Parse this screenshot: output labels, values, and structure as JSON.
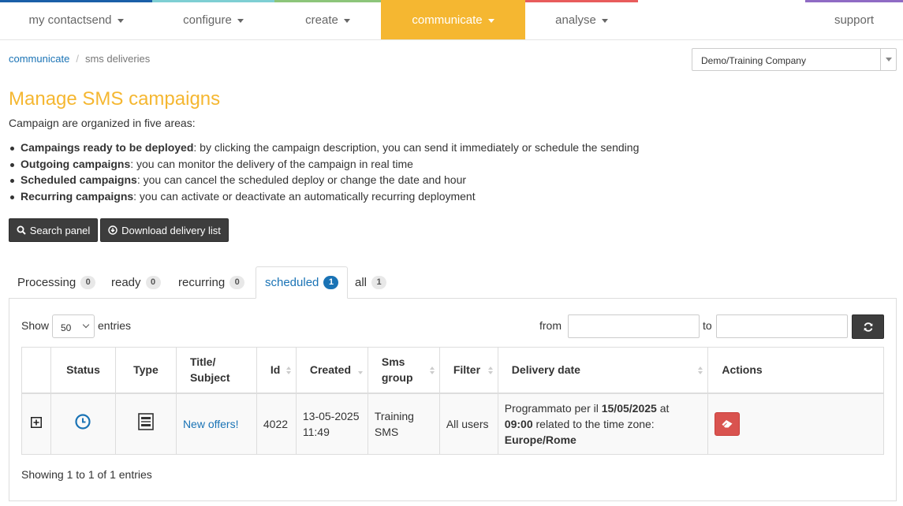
{
  "nav": {
    "items": [
      {
        "label": "my contactsend",
        "stripe": "#1a5fa8",
        "caret": true
      },
      {
        "label": "configure",
        "stripe": "#7ecfd3",
        "caret": true
      },
      {
        "label": "create",
        "stripe": "#8cc57a",
        "caret": true
      },
      {
        "label": "communicate",
        "stripe": "#f5b731",
        "caret": true,
        "active": true
      },
      {
        "label": "analyse",
        "stripe": "#e85c5c",
        "caret": true
      },
      {
        "label": "support",
        "stripe": "#8f6bc4",
        "caret": false
      }
    ]
  },
  "breadcrumb": {
    "parent": "communicate",
    "current": "sms deliveries"
  },
  "company_select": {
    "value": "Demo/Training Company"
  },
  "title": "Manage SMS campaigns",
  "intro": "Campaign are organized in five areas:",
  "bullets": [
    {
      "bold": "Campaings ready to be deployed",
      "text": ": by clicking the campaign description, you can send it immediately or schedule the sending"
    },
    {
      "bold": "Outgoing campaigns",
      "text": ": you can monitor the delivery of the campaign in real time"
    },
    {
      "bold": "Scheduled campaigns",
      "text": ": you can cancel the scheduled deploy or change the date and hour"
    },
    {
      "bold": "Recurring campaigns",
      "text": ": you can activate or deactivate an automatically recurring deployment"
    }
  ],
  "buttons": {
    "search_panel": "Search panel",
    "download": "Download delivery list"
  },
  "tabs": [
    {
      "label": "Processing",
      "count": "0"
    },
    {
      "label": "ready",
      "count": "0"
    },
    {
      "label": "recurring",
      "count": "0"
    },
    {
      "label": "scheduled",
      "count": "1",
      "active": true
    },
    {
      "label": "all",
      "count": "1"
    }
  ],
  "table_controls": {
    "show": "Show",
    "page_length": "50",
    "entries": "entries",
    "from": "from",
    "to": "to",
    "from_value": "",
    "to_value": ""
  },
  "table": {
    "headers": {
      "status": "Status",
      "type": "Type",
      "title_line1": "Title/",
      "title_line2": "Subject",
      "id": "Id",
      "created": "Created",
      "group_line1": "Sms",
      "group_line2": "group",
      "filter": "Filter",
      "delivery": "Delivery date",
      "actions": "Actions"
    },
    "row": {
      "title": "New offers!",
      "id": "4022",
      "created_date": "13-05-2025",
      "created_time": "11:49",
      "group_line1": "Training",
      "group_line2": "SMS",
      "filter": "All users",
      "delivery_prefix": "Programmato per il ",
      "delivery_date": "15/05/2025",
      "delivery_at": " at",
      "delivery_time": "09:00",
      "delivery_mid": " related to the time zone:",
      "delivery_zone": "Europe/Rome"
    }
  },
  "footer_info": "Showing 1 to 1 of 1 entries",
  "colors": {
    "accent": "#f5b731",
    "link": "#1a73b5",
    "dark_button": "#3d3d3d",
    "danger": "#d9534f"
  }
}
